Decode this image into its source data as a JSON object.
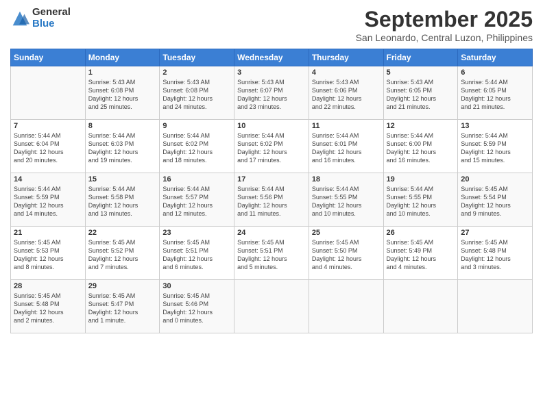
{
  "logo": {
    "general": "General",
    "blue": "Blue"
  },
  "title": "September 2025",
  "subtitle": "San Leonardo, Central Luzon, Philippines",
  "days_header": [
    "Sunday",
    "Monday",
    "Tuesday",
    "Wednesday",
    "Thursday",
    "Friday",
    "Saturday"
  ],
  "weeks": [
    [
      {
        "day": "",
        "content": ""
      },
      {
        "day": "1",
        "content": "Sunrise: 5:43 AM\nSunset: 6:08 PM\nDaylight: 12 hours\nand 25 minutes."
      },
      {
        "day": "2",
        "content": "Sunrise: 5:43 AM\nSunset: 6:08 PM\nDaylight: 12 hours\nand 24 minutes."
      },
      {
        "day": "3",
        "content": "Sunrise: 5:43 AM\nSunset: 6:07 PM\nDaylight: 12 hours\nand 23 minutes."
      },
      {
        "day": "4",
        "content": "Sunrise: 5:43 AM\nSunset: 6:06 PM\nDaylight: 12 hours\nand 22 minutes."
      },
      {
        "day": "5",
        "content": "Sunrise: 5:43 AM\nSunset: 6:05 PM\nDaylight: 12 hours\nand 21 minutes."
      },
      {
        "day": "6",
        "content": "Sunrise: 5:44 AM\nSunset: 6:05 PM\nDaylight: 12 hours\nand 21 minutes."
      }
    ],
    [
      {
        "day": "7",
        "content": "Sunrise: 5:44 AM\nSunset: 6:04 PM\nDaylight: 12 hours\nand 20 minutes."
      },
      {
        "day": "8",
        "content": "Sunrise: 5:44 AM\nSunset: 6:03 PM\nDaylight: 12 hours\nand 19 minutes."
      },
      {
        "day": "9",
        "content": "Sunrise: 5:44 AM\nSunset: 6:02 PM\nDaylight: 12 hours\nand 18 minutes."
      },
      {
        "day": "10",
        "content": "Sunrise: 5:44 AM\nSunset: 6:02 PM\nDaylight: 12 hours\nand 17 minutes."
      },
      {
        "day": "11",
        "content": "Sunrise: 5:44 AM\nSunset: 6:01 PM\nDaylight: 12 hours\nand 16 minutes."
      },
      {
        "day": "12",
        "content": "Sunrise: 5:44 AM\nSunset: 6:00 PM\nDaylight: 12 hours\nand 16 minutes."
      },
      {
        "day": "13",
        "content": "Sunrise: 5:44 AM\nSunset: 5:59 PM\nDaylight: 12 hours\nand 15 minutes."
      }
    ],
    [
      {
        "day": "14",
        "content": "Sunrise: 5:44 AM\nSunset: 5:59 PM\nDaylight: 12 hours\nand 14 minutes."
      },
      {
        "day": "15",
        "content": "Sunrise: 5:44 AM\nSunset: 5:58 PM\nDaylight: 12 hours\nand 13 minutes."
      },
      {
        "day": "16",
        "content": "Sunrise: 5:44 AM\nSunset: 5:57 PM\nDaylight: 12 hours\nand 12 minutes."
      },
      {
        "day": "17",
        "content": "Sunrise: 5:44 AM\nSunset: 5:56 PM\nDaylight: 12 hours\nand 11 minutes."
      },
      {
        "day": "18",
        "content": "Sunrise: 5:44 AM\nSunset: 5:55 PM\nDaylight: 12 hours\nand 10 minutes."
      },
      {
        "day": "19",
        "content": "Sunrise: 5:44 AM\nSunset: 5:55 PM\nDaylight: 12 hours\nand 10 minutes."
      },
      {
        "day": "20",
        "content": "Sunrise: 5:45 AM\nSunset: 5:54 PM\nDaylight: 12 hours\nand 9 minutes."
      }
    ],
    [
      {
        "day": "21",
        "content": "Sunrise: 5:45 AM\nSunset: 5:53 PM\nDaylight: 12 hours\nand 8 minutes."
      },
      {
        "day": "22",
        "content": "Sunrise: 5:45 AM\nSunset: 5:52 PM\nDaylight: 12 hours\nand 7 minutes."
      },
      {
        "day": "23",
        "content": "Sunrise: 5:45 AM\nSunset: 5:51 PM\nDaylight: 12 hours\nand 6 minutes."
      },
      {
        "day": "24",
        "content": "Sunrise: 5:45 AM\nSunset: 5:51 PM\nDaylight: 12 hours\nand 5 minutes."
      },
      {
        "day": "25",
        "content": "Sunrise: 5:45 AM\nSunset: 5:50 PM\nDaylight: 12 hours\nand 4 minutes."
      },
      {
        "day": "26",
        "content": "Sunrise: 5:45 AM\nSunset: 5:49 PM\nDaylight: 12 hours\nand 4 minutes."
      },
      {
        "day": "27",
        "content": "Sunrise: 5:45 AM\nSunset: 5:48 PM\nDaylight: 12 hours\nand 3 minutes."
      }
    ],
    [
      {
        "day": "28",
        "content": "Sunrise: 5:45 AM\nSunset: 5:48 PM\nDaylight: 12 hours\nand 2 minutes."
      },
      {
        "day": "29",
        "content": "Sunrise: 5:45 AM\nSunset: 5:47 PM\nDaylight: 12 hours\nand 1 minute."
      },
      {
        "day": "30",
        "content": "Sunrise: 5:45 AM\nSunset: 5:46 PM\nDaylight: 12 hours\nand 0 minutes."
      },
      {
        "day": "",
        "content": ""
      },
      {
        "day": "",
        "content": ""
      },
      {
        "day": "",
        "content": ""
      },
      {
        "day": "",
        "content": ""
      }
    ]
  ]
}
